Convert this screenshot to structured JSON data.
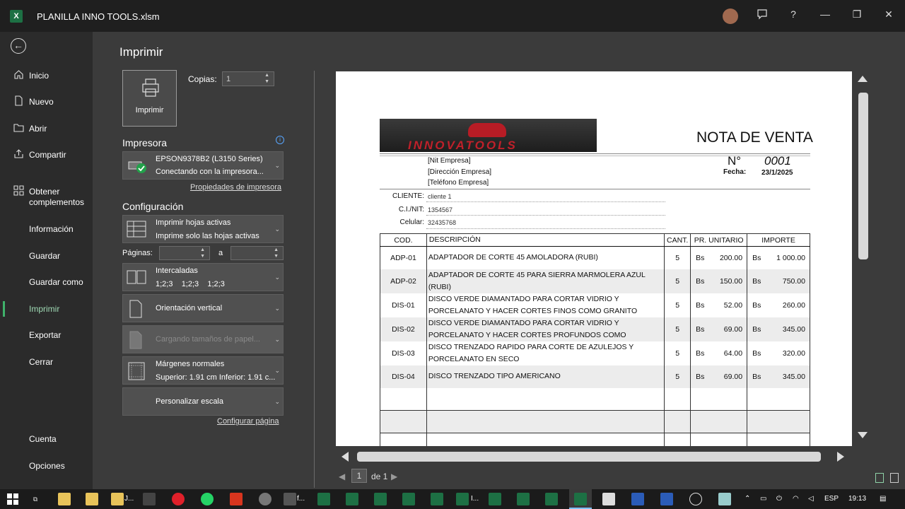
{
  "window": {
    "title": "PLANILLA INNO TOOLS.xlsm",
    "app_icon": "X"
  },
  "titlebar_buttons": {
    "help": "?",
    "minimize": "—",
    "restore": "❐",
    "close": "✕"
  },
  "nav": {
    "items": [
      {
        "label": "Inicio",
        "icon": "home-icon"
      },
      {
        "label": "Nuevo",
        "icon": "new-file-icon"
      },
      {
        "label": "Abrir",
        "icon": "folder-icon"
      },
      {
        "label": "Compartir",
        "icon": "share-icon"
      },
      {
        "label": "Obtener complementos",
        "icon": "grid-icon"
      },
      {
        "label": "Información"
      },
      {
        "label": "Guardar"
      },
      {
        "label": "Guardar como"
      },
      {
        "label": "Imprimir",
        "active": true
      },
      {
        "label": "Exportar"
      },
      {
        "label": "Cerrar"
      }
    ],
    "bottom": [
      "Cuenta",
      "Opciones"
    ]
  },
  "print": {
    "title": "Imprimir",
    "button_label": "Imprimir",
    "copies_label": "Copias:",
    "copies_value": "1",
    "printer_header": "Impresora",
    "printer_name": "EPSON9378B2 (L3150 Series)",
    "printer_status": "Conectando con la impresora...",
    "printer_props_link": "Propiedades de impresora",
    "config_header": "Configuración",
    "scope_title": "Imprimir hojas activas",
    "scope_sub": "Imprime solo las hojas activas",
    "pages_label": "Páginas:",
    "pages_to": "a",
    "collate_title": "Intercaladas",
    "collate_sub": "1;2;3    1;2;3    1;2;3",
    "orientation": "Orientación vertical",
    "paper_size": "Cargando tamaños de papel...",
    "margins_title": "Márgenes normales",
    "margins_sub": "Superior: 1.91 cm Inferior: 1.91 c...",
    "scale": "Personalizar escala",
    "page_setup_link": "Configurar página"
  },
  "pager": {
    "current": "1",
    "of_label": "de 1"
  },
  "document": {
    "logo_text": "INNOVATOOLS",
    "title": "NOTA DE VENTA",
    "number_label": "N°",
    "number_value": "0001",
    "date_label": "Fecha:",
    "date_value": "23/1/2025",
    "company": [
      "[Nit Empresa]",
      "[Dirección Empresa]",
      "[Teléfono Empresa]"
    ],
    "client_fields": [
      {
        "label": "CLIENTE:",
        "value": "cliente 1"
      },
      {
        "label": "C.I./NIT:",
        "value": "1354567"
      },
      {
        "label": "Celular:",
        "value": "32435768"
      }
    ],
    "columns": [
      "COD.",
      "DESCRIPCIÓN",
      "CANT.",
      "PR. UNITARIO",
      "IMPORTE"
    ],
    "currency": "Bs",
    "rows": [
      {
        "cod": "ADP-01",
        "desc": "ADAPTADOR DE CORTE 45 AMOLADORA (RUBI)",
        "cant": "5",
        "pu": "200.00",
        "imp": "1 000.00"
      },
      {
        "cod": "ADP-02",
        "desc": "ADAPTADOR DE CORTE 45 PARA SIERRA MARMOLERA AZUL (RUBI)",
        "cant": "5",
        "pu": "150.00",
        "imp": "750.00"
      },
      {
        "cod": "DIS-01",
        "desc": "DISCO VERDE DIAMANTADO  PARA CORTAR VIDRIO Y PORCELANATO Y HACER CORTES FINOS  COMO GRANITO",
        "cant": "5",
        "pu": "52.00",
        "imp": "260.00"
      },
      {
        "cod": "DIS-02",
        "desc": "DISCO VERDE DIAMANTADO  PARA CORTAR VIDRIO Y PORCELANATO Y HACER CORTES  PROFUNDOS  COMO",
        "cant": "5",
        "pu": "69.00",
        "imp": "345.00"
      },
      {
        "cod": "DIS-03",
        "desc": "DISCO TRENZADO RAPIDO PARA CORTE DE  AZULEJOS  Y PORCELANATO EN SECO",
        "cant": "5",
        "pu": "64.00",
        "imp": "320.00"
      },
      {
        "cod": "DIS-04",
        "desc": "DISCO TRENZADO TIPO AMERICANO",
        "cant": "5",
        "pu": "69.00",
        "imp": "345.00"
      }
    ]
  },
  "taskbar": {
    "labels": [
      "J...",
      "f...",
      "I..."
    ],
    "lang": "ESP",
    "time": "19:13"
  }
}
